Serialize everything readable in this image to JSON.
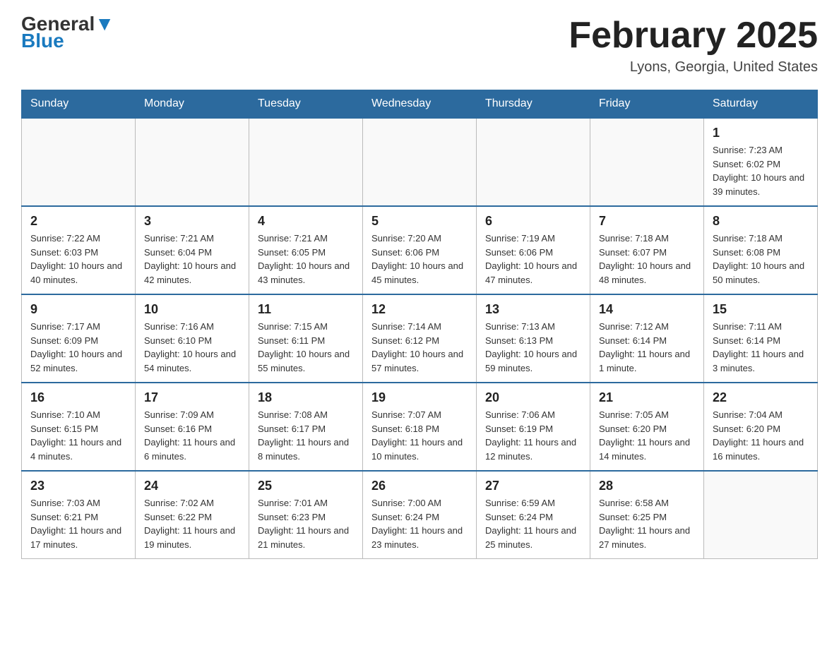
{
  "header": {
    "logo": {
      "general": "General",
      "blue": "Blue"
    },
    "title": "February 2025",
    "location": "Lyons, Georgia, United States"
  },
  "weekdays": [
    "Sunday",
    "Monday",
    "Tuesday",
    "Wednesday",
    "Thursday",
    "Friday",
    "Saturday"
  ],
  "weeks": [
    [
      {
        "day": "",
        "info": ""
      },
      {
        "day": "",
        "info": ""
      },
      {
        "day": "",
        "info": ""
      },
      {
        "day": "",
        "info": ""
      },
      {
        "day": "",
        "info": ""
      },
      {
        "day": "",
        "info": ""
      },
      {
        "day": "1",
        "info": "Sunrise: 7:23 AM\nSunset: 6:02 PM\nDaylight: 10 hours and 39 minutes."
      }
    ],
    [
      {
        "day": "2",
        "info": "Sunrise: 7:22 AM\nSunset: 6:03 PM\nDaylight: 10 hours and 40 minutes."
      },
      {
        "day": "3",
        "info": "Sunrise: 7:21 AM\nSunset: 6:04 PM\nDaylight: 10 hours and 42 minutes."
      },
      {
        "day": "4",
        "info": "Sunrise: 7:21 AM\nSunset: 6:05 PM\nDaylight: 10 hours and 43 minutes."
      },
      {
        "day": "5",
        "info": "Sunrise: 7:20 AM\nSunset: 6:06 PM\nDaylight: 10 hours and 45 minutes."
      },
      {
        "day": "6",
        "info": "Sunrise: 7:19 AM\nSunset: 6:06 PM\nDaylight: 10 hours and 47 minutes."
      },
      {
        "day": "7",
        "info": "Sunrise: 7:18 AM\nSunset: 6:07 PM\nDaylight: 10 hours and 48 minutes."
      },
      {
        "day": "8",
        "info": "Sunrise: 7:18 AM\nSunset: 6:08 PM\nDaylight: 10 hours and 50 minutes."
      }
    ],
    [
      {
        "day": "9",
        "info": "Sunrise: 7:17 AM\nSunset: 6:09 PM\nDaylight: 10 hours and 52 minutes."
      },
      {
        "day": "10",
        "info": "Sunrise: 7:16 AM\nSunset: 6:10 PM\nDaylight: 10 hours and 54 minutes."
      },
      {
        "day": "11",
        "info": "Sunrise: 7:15 AM\nSunset: 6:11 PM\nDaylight: 10 hours and 55 minutes."
      },
      {
        "day": "12",
        "info": "Sunrise: 7:14 AM\nSunset: 6:12 PM\nDaylight: 10 hours and 57 minutes."
      },
      {
        "day": "13",
        "info": "Sunrise: 7:13 AM\nSunset: 6:13 PM\nDaylight: 10 hours and 59 minutes."
      },
      {
        "day": "14",
        "info": "Sunrise: 7:12 AM\nSunset: 6:14 PM\nDaylight: 11 hours and 1 minute."
      },
      {
        "day": "15",
        "info": "Sunrise: 7:11 AM\nSunset: 6:14 PM\nDaylight: 11 hours and 3 minutes."
      }
    ],
    [
      {
        "day": "16",
        "info": "Sunrise: 7:10 AM\nSunset: 6:15 PM\nDaylight: 11 hours and 4 minutes."
      },
      {
        "day": "17",
        "info": "Sunrise: 7:09 AM\nSunset: 6:16 PM\nDaylight: 11 hours and 6 minutes."
      },
      {
        "day": "18",
        "info": "Sunrise: 7:08 AM\nSunset: 6:17 PM\nDaylight: 11 hours and 8 minutes."
      },
      {
        "day": "19",
        "info": "Sunrise: 7:07 AM\nSunset: 6:18 PM\nDaylight: 11 hours and 10 minutes."
      },
      {
        "day": "20",
        "info": "Sunrise: 7:06 AM\nSunset: 6:19 PM\nDaylight: 11 hours and 12 minutes."
      },
      {
        "day": "21",
        "info": "Sunrise: 7:05 AM\nSunset: 6:20 PM\nDaylight: 11 hours and 14 minutes."
      },
      {
        "day": "22",
        "info": "Sunrise: 7:04 AM\nSunset: 6:20 PM\nDaylight: 11 hours and 16 minutes."
      }
    ],
    [
      {
        "day": "23",
        "info": "Sunrise: 7:03 AM\nSunset: 6:21 PM\nDaylight: 11 hours and 17 minutes."
      },
      {
        "day": "24",
        "info": "Sunrise: 7:02 AM\nSunset: 6:22 PM\nDaylight: 11 hours and 19 minutes."
      },
      {
        "day": "25",
        "info": "Sunrise: 7:01 AM\nSunset: 6:23 PM\nDaylight: 11 hours and 21 minutes."
      },
      {
        "day": "26",
        "info": "Sunrise: 7:00 AM\nSunset: 6:24 PM\nDaylight: 11 hours and 23 minutes."
      },
      {
        "day": "27",
        "info": "Sunrise: 6:59 AM\nSunset: 6:24 PM\nDaylight: 11 hours and 25 minutes."
      },
      {
        "day": "28",
        "info": "Sunrise: 6:58 AM\nSunset: 6:25 PM\nDaylight: 11 hours and 27 minutes."
      },
      {
        "day": "",
        "info": ""
      }
    ]
  ]
}
